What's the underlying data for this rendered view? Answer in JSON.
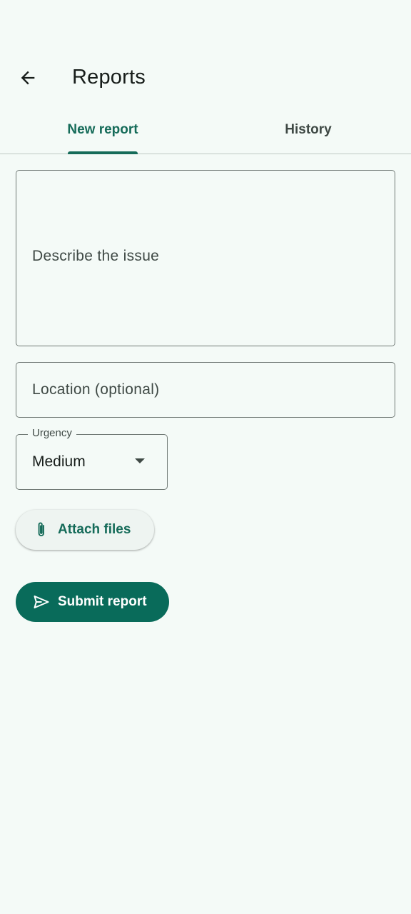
{
  "header": {
    "back_icon": "arrow-back-icon",
    "title": "Reports"
  },
  "tabs": [
    {
      "label": "New report",
      "selected": true
    },
    {
      "label": "History",
      "selected": false
    }
  ],
  "form": {
    "description": {
      "placeholder": "Describe the issue",
      "value": ""
    },
    "location": {
      "placeholder": "Location (optional)",
      "value": ""
    },
    "urgency": {
      "label": "Urgency",
      "value": "Medium",
      "icon": "dropdown-arrow-icon"
    }
  },
  "actions": {
    "attach": {
      "label": "Attach files",
      "icon": "paperclip-icon"
    },
    "submit": {
      "label": "Submit report",
      "icon": "send-icon"
    }
  },
  "colors": {
    "accent": "#156b59",
    "primary_button": "#096b5a",
    "background": "#f4faf7"
  }
}
